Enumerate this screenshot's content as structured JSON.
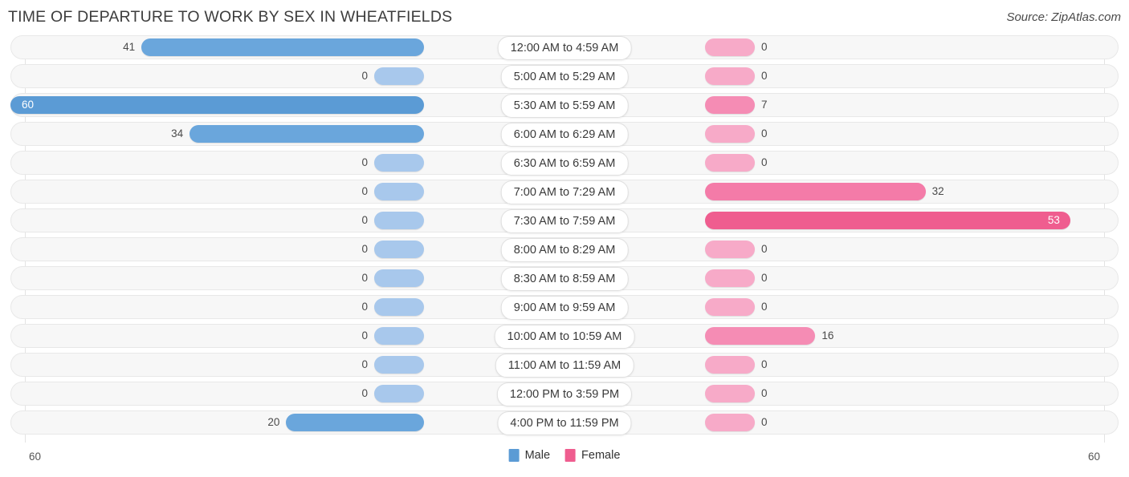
{
  "header": {
    "title": "TIME OF DEPARTURE TO WORK BY SEX IN WHEATFIELDS",
    "source": "Source: ZipAtlas.com"
  },
  "footer": {
    "axis_left": "60",
    "axis_right": "60",
    "legend": [
      {
        "label": "Male",
        "color": "#5b9bd5"
      },
      {
        "label": "Female",
        "color": "#ef5d8f"
      }
    ]
  },
  "chart_data": {
    "type": "bar",
    "title": "TIME OF DEPARTURE TO WORK BY SEX IN WHEATFIELDS",
    "orientation": "horizontal-diverging",
    "xlabel": "",
    "ylabel": "",
    "xlim": [
      0,
      60
    ],
    "grid": true,
    "legend_position": "bottom-center",
    "categories": [
      "12:00 AM to 4:59 AM",
      "5:00 AM to 5:29 AM",
      "5:30 AM to 5:59 AM",
      "6:00 AM to 6:29 AM",
      "6:30 AM to 6:59 AM",
      "7:00 AM to 7:29 AM",
      "7:30 AM to 7:59 AM",
      "8:00 AM to 8:29 AM",
      "8:30 AM to 8:59 AM",
      "9:00 AM to 9:59 AM",
      "10:00 AM to 10:59 AM",
      "11:00 AM to 11:59 AM",
      "12:00 PM to 3:59 PM",
      "4:00 PM to 11:59 PM"
    ],
    "series": [
      {
        "name": "Male",
        "color": "#5b9bd5",
        "values": [
          41,
          0,
          60,
          34,
          0,
          0,
          0,
          0,
          0,
          0,
          0,
          0,
          0,
          20
        ]
      },
      {
        "name": "Female",
        "color": "#ef5d8f",
        "values": [
          0,
          0,
          7,
          0,
          0,
          32,
          53,
          0,
          0,
          0,
          16,
          0,
          0,
          0
        ]
      }
    ]
  },
  "rows": [
    {
      "label": "12:00 AM to 4:59 AM",
      "male": "41",
      "female": "0"
    },
    {
      "label": "5:00 AM to 5:29 AM",
      "male": "0",
      "female": "0"
    },
    {
      "label": "5:30 AM to 5:59 AM",
      "male": "60",
      "female": "7"
    },
    {
      "label": "6:00 AM to 6:29 AM",
      "male": "34",
      "female": "0"
    },
    {
      "label": "6:30 AM to 6:59 AM",
      "male": "0",
      "female": "0"
    },
    {
      "label": "7:00 AM to 7:29 AM",
      "male": "0",
      "female": "32"
    },
    {
      "label": "7:30 AM to 7:59 AM",
      "male": "0",
      "female": "53"
    },
    {
      "label": "8:00 AM to 8:29 AM",
      "male": "0",
      "female": "0"
    },
    {
      "label": "8:30 AM to 8:59 AM",
      "male": "0",
      "female": "0"
    },
    {
      "label": "9:00 AM to 9:59 AM",
      "male": "0",
      "female": "0"
    },
    {
      "label": "10:00 AM to 10:59 AM",
      "male": "0",
      "female": "16"
    },
    {
      "label": "11:00 AM to 11:59 AM",
      "male": "0",
      "female": "0"
    },
    {
      "label": "12:00 PM to 3:59 PM",
      "male": "0",
      "female": "0"
    },
    {
      "label": "4:00 PM to 11:59 PM",
      "male": "20",
      "female": "0"
    }
  ]
}
